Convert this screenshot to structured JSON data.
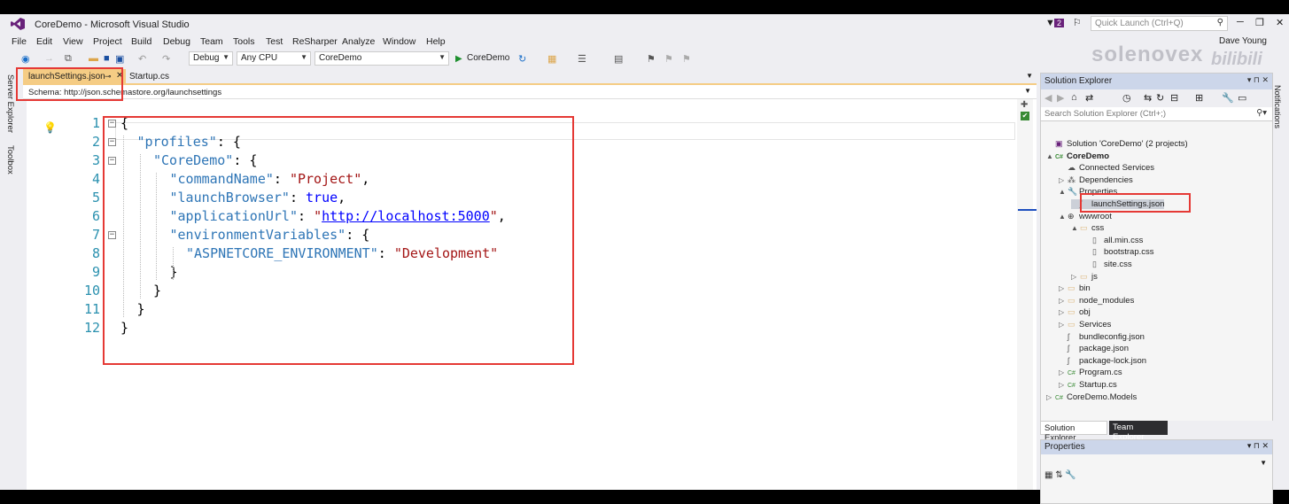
{
  "window": {
    "title": "CoreDemo - Microsoft Visual Studio",
    "quick_launch_placeholder": "Quick Launch (Ctrl+Q)",
    "notification_count": "2",
    "user": "Dave Young"
  },
  "menu": [
    "File",
    "Edit",
    "View",
    "Project",
    "Build",
    "Debug",
    "Team",
    "Tools",
    "Test",
    "ReSharper",
    "Analyze",
    "Window",
    "Help"
  ],
  "toolbar": {
    "config": "Debug",
    "platform": "Any CPU",
    "startup": "CoreDemo",
    "run_label": "CoreDemo"
  },
  "watermark": {
    "brand": "solenovex",
    "logo": "bilibili"
  },
  "side_tabs": [
    "Server Explorer",
    "Toolbox"
  ],
  "editor": {
    "tabs": [
      {
        "label": "launchSettings.json",
        "active": true
      },
      {
        "label": "Startup.cs",
        "active": false
      }
    ],
    "schema": "Schema:  http://json.schemastore.org/launchsettings",
    "lines": [
      {
        "n": "1",
        "indent": 0,
        "parts": [
          {
            "t": "{",
            "c": ""
          }
        ]
      },
      {
        "n": "2",
        "indent": 1,
        "parts": [
          {
            "t": "\"profiles\"",
            "c": "k"
          },
          {
            "t": ": {",
            "c": ""
          }
        ]
      },
      {
        "n": "3",
        "indent": 2,
        "parts": [
          {
            "t": "\"CoreDemo\"",
            "c": "k"
          },
          {
            "t": ": {",
            "c": ""
          }
        ]
      },
      {
        "n": "4",
        "indent": 3,
        "parts": [
          {
            "t": "\"commandName\"",
            "c": "k"
          },
          {
            "t": ": ",
            "c": ""
          },
          {
            "t": "\"Project\"",
            "c": "s"
          },
          {
            "t": ",",
            "c": ""
          }
        ]
      },
      {
        "n": "5",
        "indent": 3,
        "parts": [
          {
            "t": "\"launchBrowser\"",
            "c": "k"
          },
          {
            "t": ": ",
            "c": ""
          },
          {
            "t": "true",
            "c": "b"
          },
          {
            "t": ",",
            "c": ""
          }
        ]
      },
      {
        "n": "6",
        "indent": 3,
        "parts": [
          {
            "t": "\"applicationUrl\"",
            "c": "k"
          },
          {
            "t": ": ",
            "c": ""
          },
          {
            "t": "\"",
            "c": "s"
          },
          {
            "t": "http://localhost:5000",
            "c": "u"
          },
          {
            "t": "\"",
            "c": "s"
          },
          {
            "t": ",",
            "c": ""
          }
        ]
      },
      {
        "n": "7",
        "indent": 3,
        "parts": [
          {
            "t": "\"environmentVariables\"",
            "c": "k"
          },
          {
            "t": ": {",
            "c": ""
          }
        ]
      },
      {
        "n": "8",
        "indent": 4,
        "parts": [
          {
            "t": "\"ASPNETCORE_ENVIRONMENT\"",
            "c": "k"
          },
          {
            "t": ": ",
            "c": ""
          },
          {
            "t": "\"Development\"",
            "c": "s"
          }
        ]
      },
      {
        "n": "9",
        "indent": 3,
        "parts": [
          {
            "t": "}",
            "c": ""
          }
        ]
      },
      {
        "n": "10",
        "indent": 2,
        "parts": [
          {
            "t": "}",
            "c": ""
          }
        ]
      },
      {
        "n": "11",
        "indent": 1,
        "parts": [
          {
            "t": "}",
            "c": ""
          }
        ]
      },
      {
        "n": "12",
        "indent": 0,
        "parts": [
          {
            "t": "}",
            "c": ""
          }
        ]
      }
    ]
  },
  "solution_explorer": {
    "title": "Solution Explorer",
    "search_placeholder": "Search Solution Explorer (Ctrl+;)",
    "nodes": [
      {
        "label": "Solution 'CoreDemo' (2 projects)",
        "level": 0,
        "expander": "",
        "icon": "solution-icon"
      },
      {
        "label": "CoreDemo",
        "level": 0,
        "expander": "▲",
        "icon": "csproj-icon",
        "bold": true
      },
      {
        "label": "Connected Services",
        "level": 1,
        "expander": "",
        "icon": "cloud-icon"
      },
      {
        "label": "Dependencies",
        "level": 1,
        "expander": "▷",
        "icon": "dependencies-icon"
      },
      {
        "label": "Properties",
        "level": 1,
        "expander": "▲",
        "icon": "wrench-icon"
      },
      {
        "label": "launchSettings.json",
        "level": 2,
        "expander": "",
        "icon": "json-file-icon",
        "selected": true
      },
      {
        "label": "wwwroot",
        "level": 1,
        "expander": "▲",
        "icon": "globe-icon"
      },
      {
        "label": "css",
        "level": 2,
        "expander": "▲",
        "icon": "folder-icon"
      },
      {
        "label": "all.min.css",
        "level": 3,
        "expander": "",
        "icon": "file-icon"
      },
      {
        "label": "bootstrap.css",
        "level": 3,
        "expander": "",
        "icon": "file-icon"
      },
      {
        "label": "site.css",
        "level": 3,
        "expander": "",
        "icon": "file-icon"
      },
      {
        "label": "js",
        "level": 2,
        "expander": "▷",
        "icon": "folder-icon"
      },
      {
        "label": "bin",
        "level": 1,
        "expander": "▷",
        "icon": "folder-icon"
      },
      {
        "label": "node_modules",
        "level": 1,
        "expander": "▷",
        "icon": "folder-icon"
      },
      {
        "label": "obj",
        "level": 1,
        "expander": "▷",
        "icon": "folder-icon"
      },
      {
        "label": "Services",
        "level": 1,
        "expander": "▷",
        "icon": "folder-icon"
      },
      {
        "label": "bundleconfig.json",
        "level": 1,
        "expander": "",
        "icon": "json-file-icon"
      },
      {
        "label": "package.json",
        "level": 1,
        "expander": "",
        "icon": "json-file-icon"
      },
      {
        "label": "package-lock.json",
        "level": 1,
        "expander": "",
        "icon": "json-file-icon"
      },
      {
        "label": "Program.cs",
        "level": 1,
        "expander": "▷",
        "icon": "csharp-icon"
      },
      {
        "label": "Startup.cs",
        "level": 1,
        "expander": "▷",
        "icon": "csharp-icon"
      },
      {
        "label": "CoreDemo.Models",
        "level": 0,
        "expander": "▷",
        "icon": "csproj-icon"
      }
    ],
    "bottom_tabs": [
      {
        "label": "Solution Explorer",
        "active": true
      },
      {
        "label": "Team Explorer",
        "active": false
      }
    ]
  },
  "properties": {
    "title": "Properties"
  },
  "notifications": "Notifications"
}
